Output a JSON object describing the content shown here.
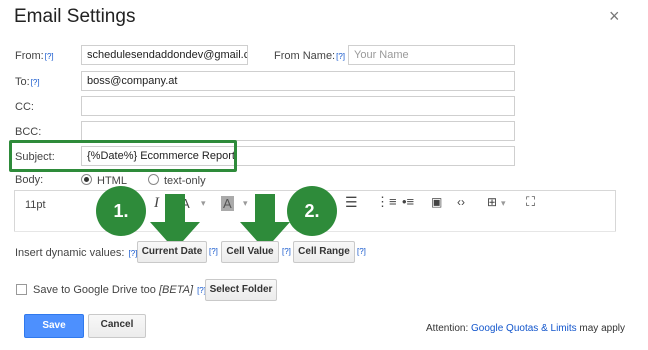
{
  "dialog": {
    "title": "Email Settings",
    "close_glyph": "×"
  },
  "help_marker": "[?]",
  "from": {
    "label": "From:",
    "value": "schedulesendaddondev@gmail.c"
  },
  "from_name": {
    "label": "From Name:",
    "placeholder": "Your Name"
  },
  "to": {
    "label": "To:",
    "value": "boss@company.at"
  },
  "cc": {
    "label": "CC:",
    "value": ""
  },
  "bcc": {
    "label": "BCC:",
    "value": ""
  },
  "subject": {
    "label": "Subject:",
    "value": "{%Date%} Ecommerce Report"
  },
  "body": {
    "label": "Body:",
    "format_options": [
      "HTML",
      "text-only"
    ],
    "selected": "HTML"
  },
  "editor_toolbar": {
    "font_size": "11pt"
  },
  "dynamic_values": {
    "label": "Insert dynamic values:",
    "buttons": [
      "Current Date",
      "Cell Value",
      "Cell Range"
    ]
  },
  "callouts": [
    "1.",
    "2."
  ],
  "drive": {
    "label": "Save to Google Drive too",
    "beta": "[BETA]",
    "select_folder": "Select Folder"
  },
  "actions": {
    "save": "Save",
    "cancel": "Cancel"
  },
  "attention": {
    "prefix": "Attention: ",
    "link": "Google Quotas & Limits",
    "suffix": " may apply"
  },
  "colors": {
    "accent_green": "#2e8b3a",
    "save_blue": "#4d90fe",
    "link_blue": "#1155cc"
  }
}
